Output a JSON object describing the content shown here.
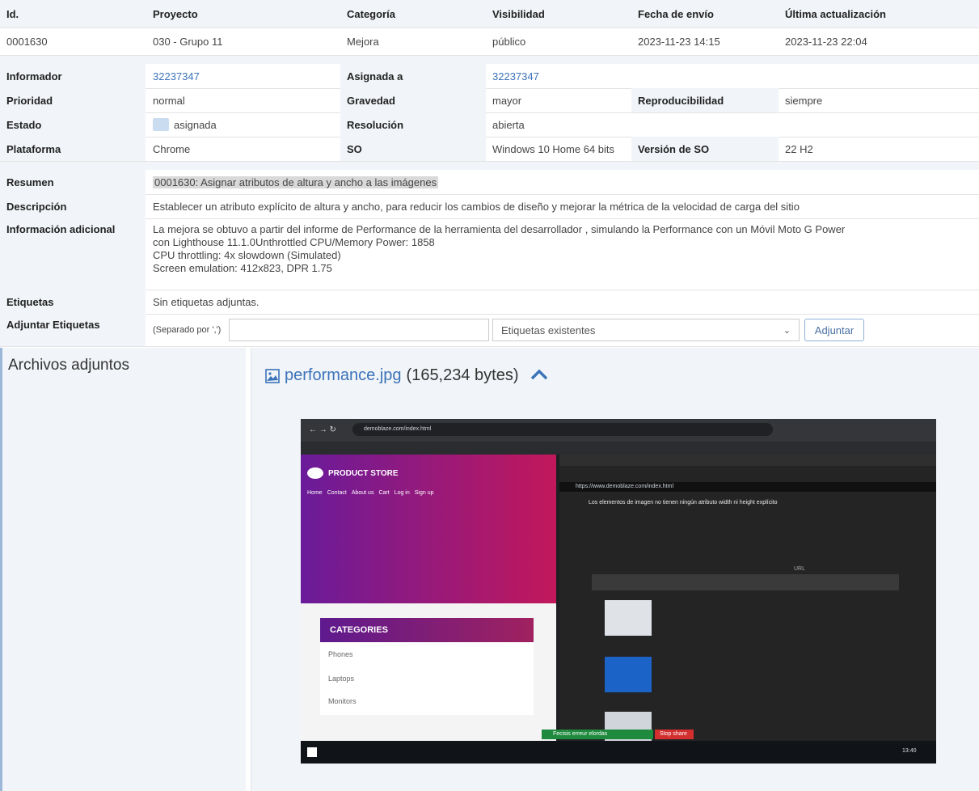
{
  "header": {
    "id": "Id.",
    "project": "Proyecto",
    "category": "Categoría",
    "visibility": "Visibilidad",
    "submitted": "Fecha de envío",
    "updated": "Última actualización"
  },
  "issue": {
    "id": "0001630",
    "project": "030 - Grupo 11",
    "category": "Mejora",
    "visibility": "público",
    "submitted": "2023-11-23 14:15",
    "updated": "2023-11-23 22:04"
  },
  "details": {
    "reporter_label": "Informador",
    "reporter": "32237347",
    "assigned_label": "Asignada a",
    "assigned": "32237347",
    "priority_label": "Prioridad",
    "priority": "normal",
    "severity_label": "Gravedad",
    "severity": "mayor",
    "reproducibility_label": "Reproducibilidad",
    "reproducibility": "siempre",
    "status_label": "Estado",
    "status": "asignada",
    "resolution_label": "Resolución",
    "resolution": "abierta",
    "platform_label": "Plataforma",
    "platform": "Chrome",
    "os_label": "SO",
    "os": "Windows 10 Home 64 bits",
    "os_version_label": "Versión de SO",
    "os_version": "22 H2"
  },
  "text": {
    "summary_label": "Resumen",
    "summary": "0001630: Asignar atributos de altura y ancho a las imágenes",
    "description_label": "Descripción",
    "description": "Establecer un atributo explícito de altura y ancho, para reducir los cambios de diseño y mejorar la métrica de la velocidad de carga del sitio",
    "additional_label": "Información adicional",
    "additional_lines": [
      "La mejora se obtuvo a partir del informe de Performance de la herramienta del desarrollador , simulando la Performance con un Móvil Moto G Power",
      "con Lighthouse 11.1.0Unthrottled CPU/Memory Power: 1858",
      "CPU throttling: 4x slowdown (Simulated)",
      "Screen emulation: 412x823, DPR 1.75"
    ],
    "tags_label": "Etiquetas",
    "tags": "Sin etiquetas adjuntas.",
    "attach_tags_label": "Adjuntar Etiquetas",
    "tags_hint": "(Separado por ',')",
    "tags_select": "Etiquetas existentes",
    "attach_button": "Adjuntar"
  },
  "attachments": {
    "title": "Archivos adjuntos",
    "file_name": "performance.jpg",
    "file_size": "(165,234 bytes)"
  },
  "screenshot": {
    "url": "demoblaze.com/index.html",
    "store_name": "PRODUCT STORE",
    "nav": [
      "Home",
      "Contact",
      "About us",
      "Cart",
      "Log in",
      "Sign up"
    ],
    "categories_title": "CATEGORIES",
    "categories": [
      "Phones",
      "Laptops",
      "Monitors"
    ],
    "devtools_url": "https://www.demoblaze.com/index.html",
    "audit_title": "Los elementos de imagen no tienen ningún atributo width ni height explícito",
    "url_col": "URL",
    "share_bar": "Fecisis erreur elordas",
    "stop": "Stop share",
    "time": "13:40"
  },
  "colors": {
    "header_bg": "#f1f4f8",
    "link": "#3b73b9",
    "store_gradient_start": "#6a1b9a",
    "store_gradient_end": "#c2185b"
  }
}
